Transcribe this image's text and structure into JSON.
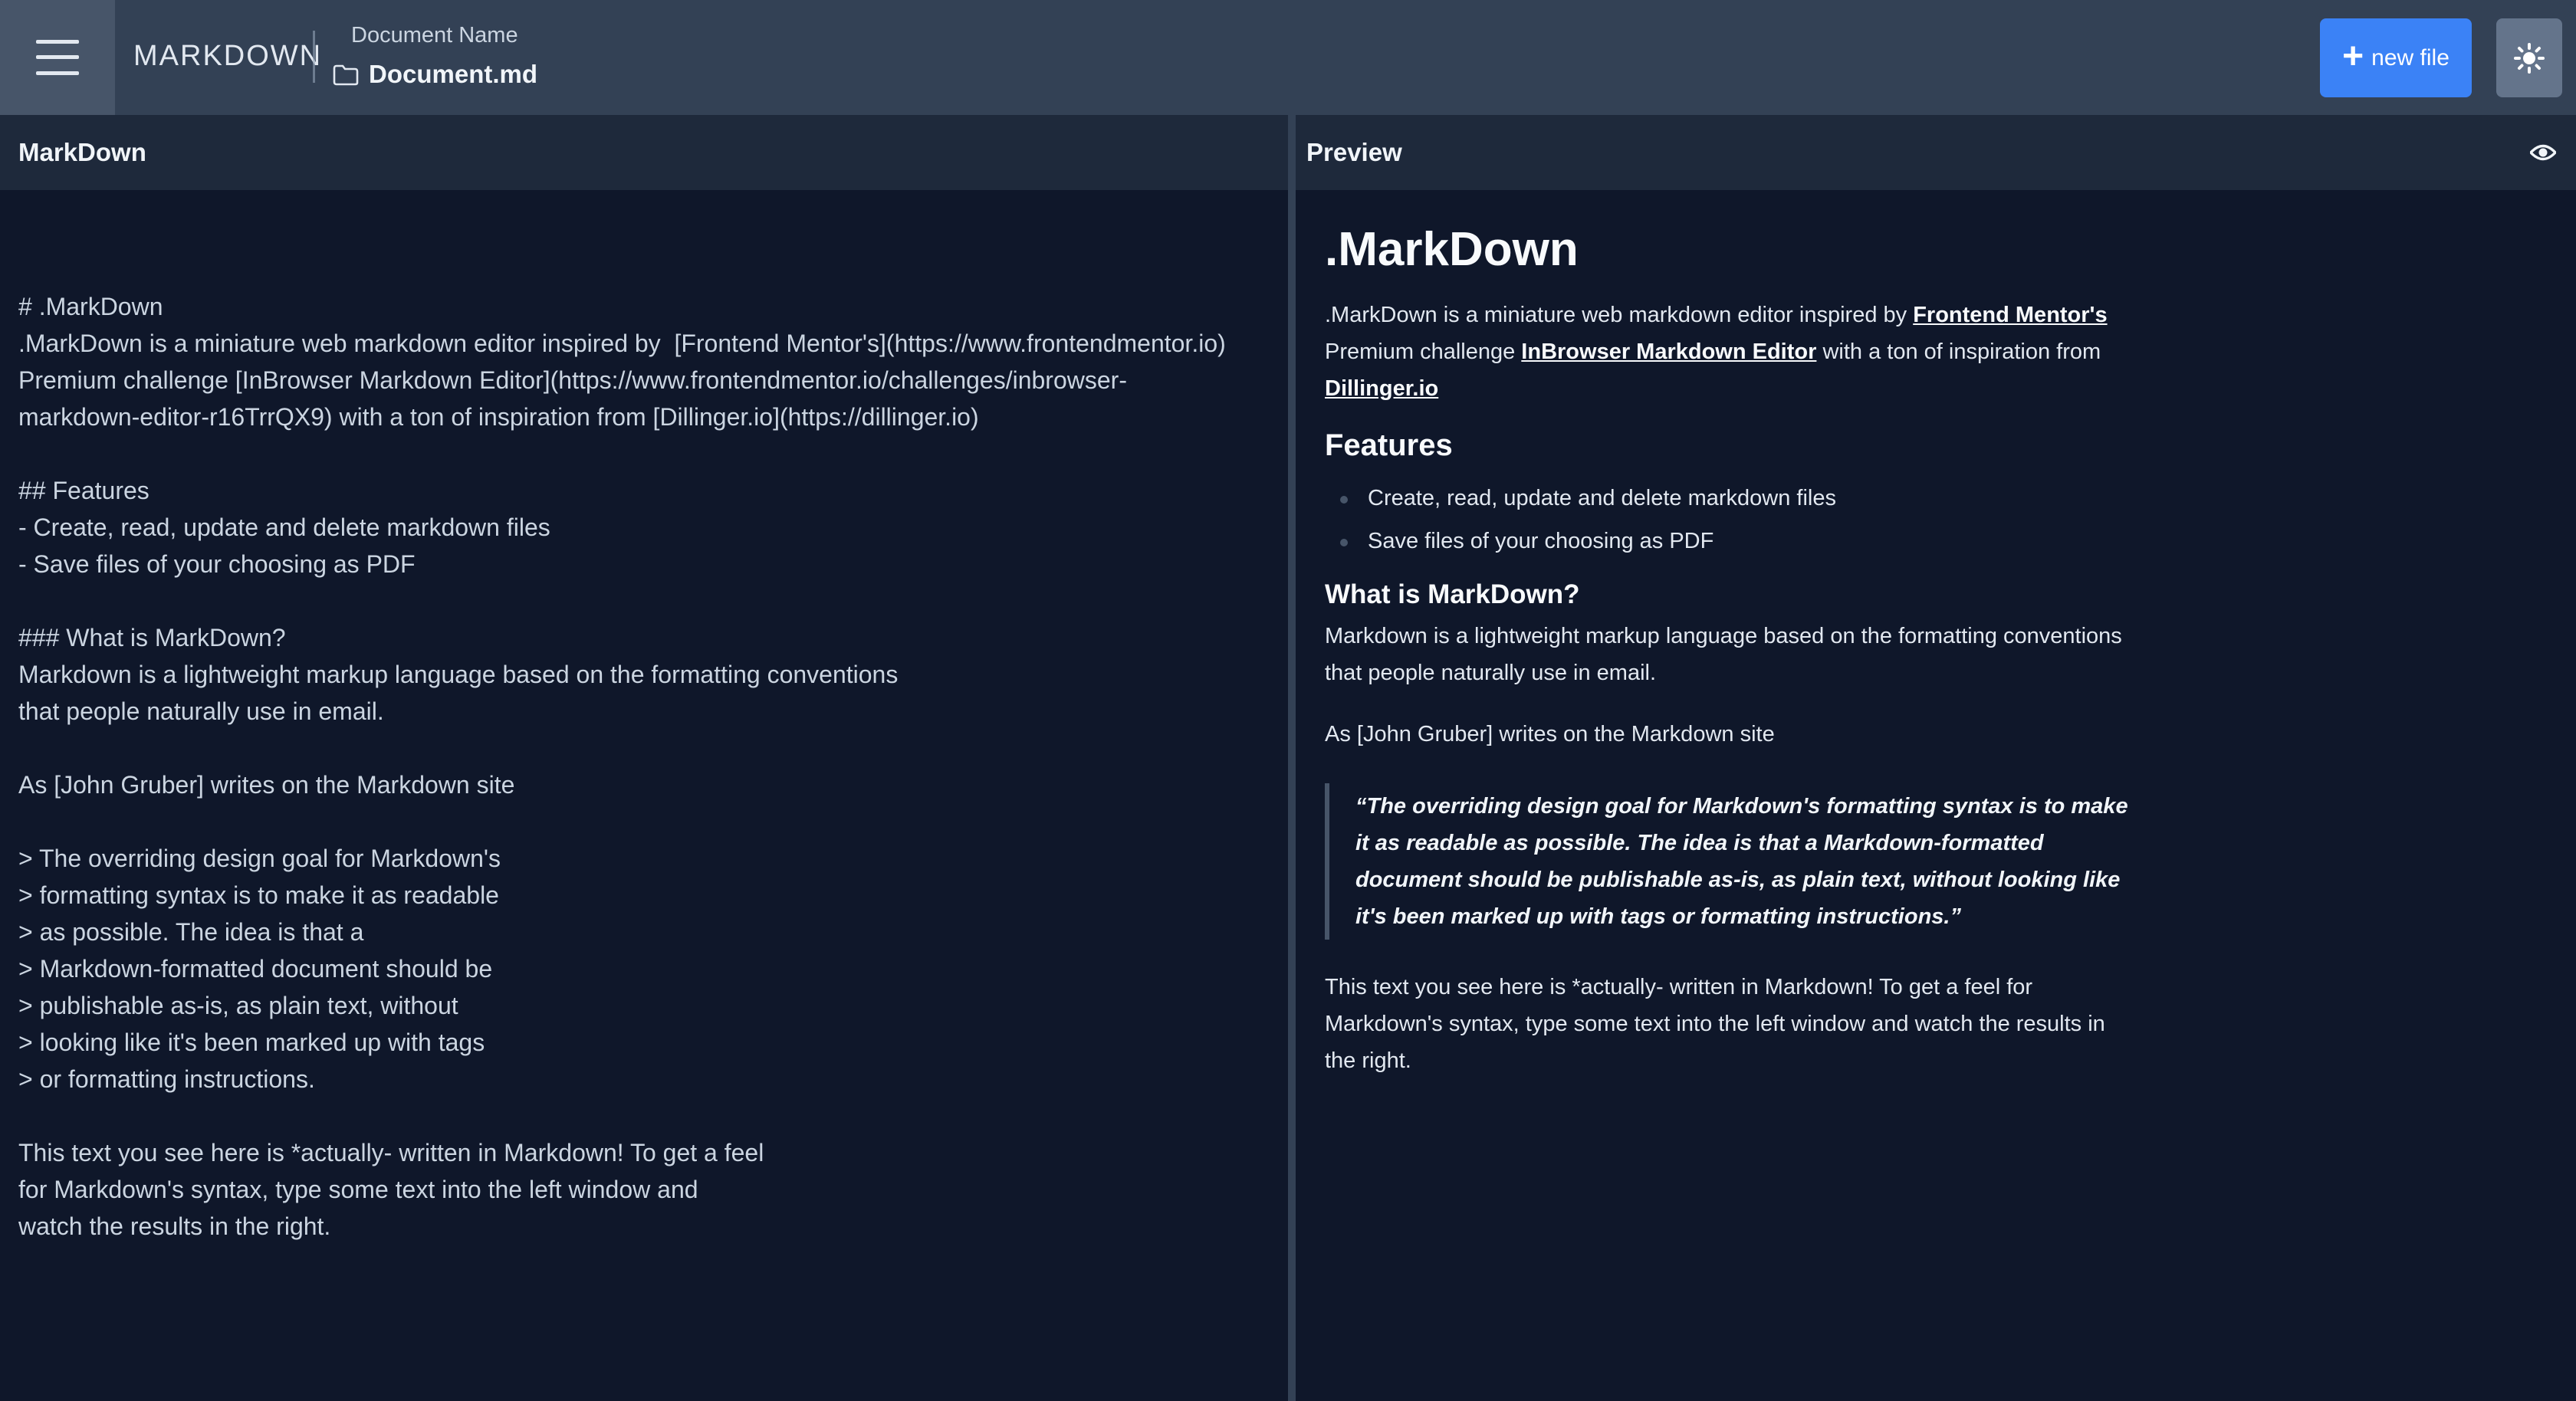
{
  "topbar": {
    "app_name": "MARKDOWN",
    "doc_label": "Document Name",
    "doc_filename": "Document.md",
    "new_file_label": "new file"
  },
  "editor": {
    "title": "MarkDown",
    "content": "# .MarkDown\n.MarkDown is a miniature web markdown editor inspired by  [Frontend Mentor's](https://www.frontendmentor.io)\nPremium challenge [InBrowser Markdown Editor](https://www.frontendmentor.io/challenges/inbrowser-\nmarkdown-editor-r16TrrQX9) with a ton of inspiration from [Dillinger.io](https://dillinger.io)\n\n## Features\n- Create, read, update and delete markdown files\n- Save files of your choosing as PDF\n\n### What is MarkDown?\nMarkdown is a lightweight markup language based on the formatting conventions\nthat people naturally use in email.\n\nAs [John Gruber] writes on the Markdown site\n\n> The overriding design goal for Markdown's\n> formatting syntax is to make it as readable\n> as possible. The idea is that a\n> Markdown-formatted document should be\n> publishable as-is, as plain text, without\n> looking like it's been marked up with tags\n> or formatting instructions.\n\nThis text you see here is *actually- written in Markdown! To get a feel\nfor Markdown's syntax, type some text into the left window and\nwatch the results in the right."
  },
  "preview": {
    "title": "Preview",
    "h1": ".MarkDown",
    "intro_part1": ".MarkDown is a miniature web markdown editor inspired by ",
    "intro_link1": "Frontend Mentor's",
    "intro_part2": " Premium challenge ",
    "intro_link2": "InBrowser Markdown Editor",
    "intro_part3": " with a ton of inspiration from ",
    "intro_link3": "Dillinger.io",
    "features_heading": "Features",
    "features": [
      "Create, read, update and delete markdown files",
      "Save files of your choosing as PDF"
    ],
    "what_heading": "What is MarkDown?",
    "what_text": "Markdown is a lightweight markup language based on the formatting conventions that people naturally use in email.",
    "gruber_text": "As [John Gruber] writes on the Markdown site",
    "quote": "“The overriding design goal for Markdown's formatting syntax is to make it as readable as possible. The idea is that a Markdown-formatted document should be publishable as-is, as plain text, without looking like it's been marked up with tags or formatting instructions.”",
    "closing": "This text you see here is *actually- written in Markdown! To get a feel for Markdown's syntax, type some text into the left window and watch the results in the right."
  },
  "icons": {
    "menu": "hamburger-menu-icon",
    "folder": "folder-icon",
    "plus": "plus-icon",
    "theme": "sun-icon",
    "eye": "eye-icon"
  },
  "colors": {
    "topbar": "#334155",
    "accent": "#3b82f6",
    "background": "#0f172a",
    "pane_header": "#1e293b"
  }
}
